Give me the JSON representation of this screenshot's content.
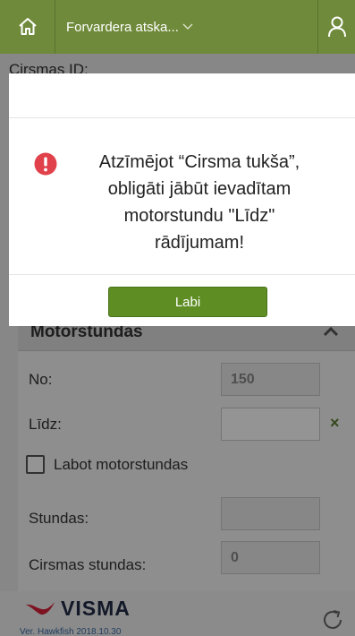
{
  "header": {
    "title": "Forvardera atska...",
    "home_icon": "home-icon",
    "user_icon": "user-icon",
    "dropdown_icon": "chevron-down-icon"
  },
  "page": {
    "cirsmas_id_label": "Cirsmas ID:"
  },
  "motorstundas": {
    "title": "Motorstundas",
    "no_label": "No:",
    "no_value": "150",
    "lidz_label": "Līdz:",
    "lidz_value": "",
    "clear_symbol": "×",
    "labot_label": "Labot motorstundas",
    "stundas_label": "Stundas:",
    "stundas_value": "",
    "cirsmas_stundas_label": "Cirsmas stundas:",
    "cirsmas_stundas_value": "0"
  },
  "footer": {
    "brand": "VISMA",
    "version": "Ver. Hawkfish 2018.10.30"
  },
  "dialog": {
    "message_lines": [
      "Atzīmējot “Cirsma tukša”,",
      "obligāti jābūt ievadītam",
      "motorstundu \"Līdz\"",
      "rādījumam!"
    ],
    "ok_label": "Labi"
  },
  "colors": {
    "topbar": "#6f8a3a",
    "ok_button": "#5e8d24",
    "warning": "#e0414a",
    "brand_red": "#d71f3a"
  }
}
